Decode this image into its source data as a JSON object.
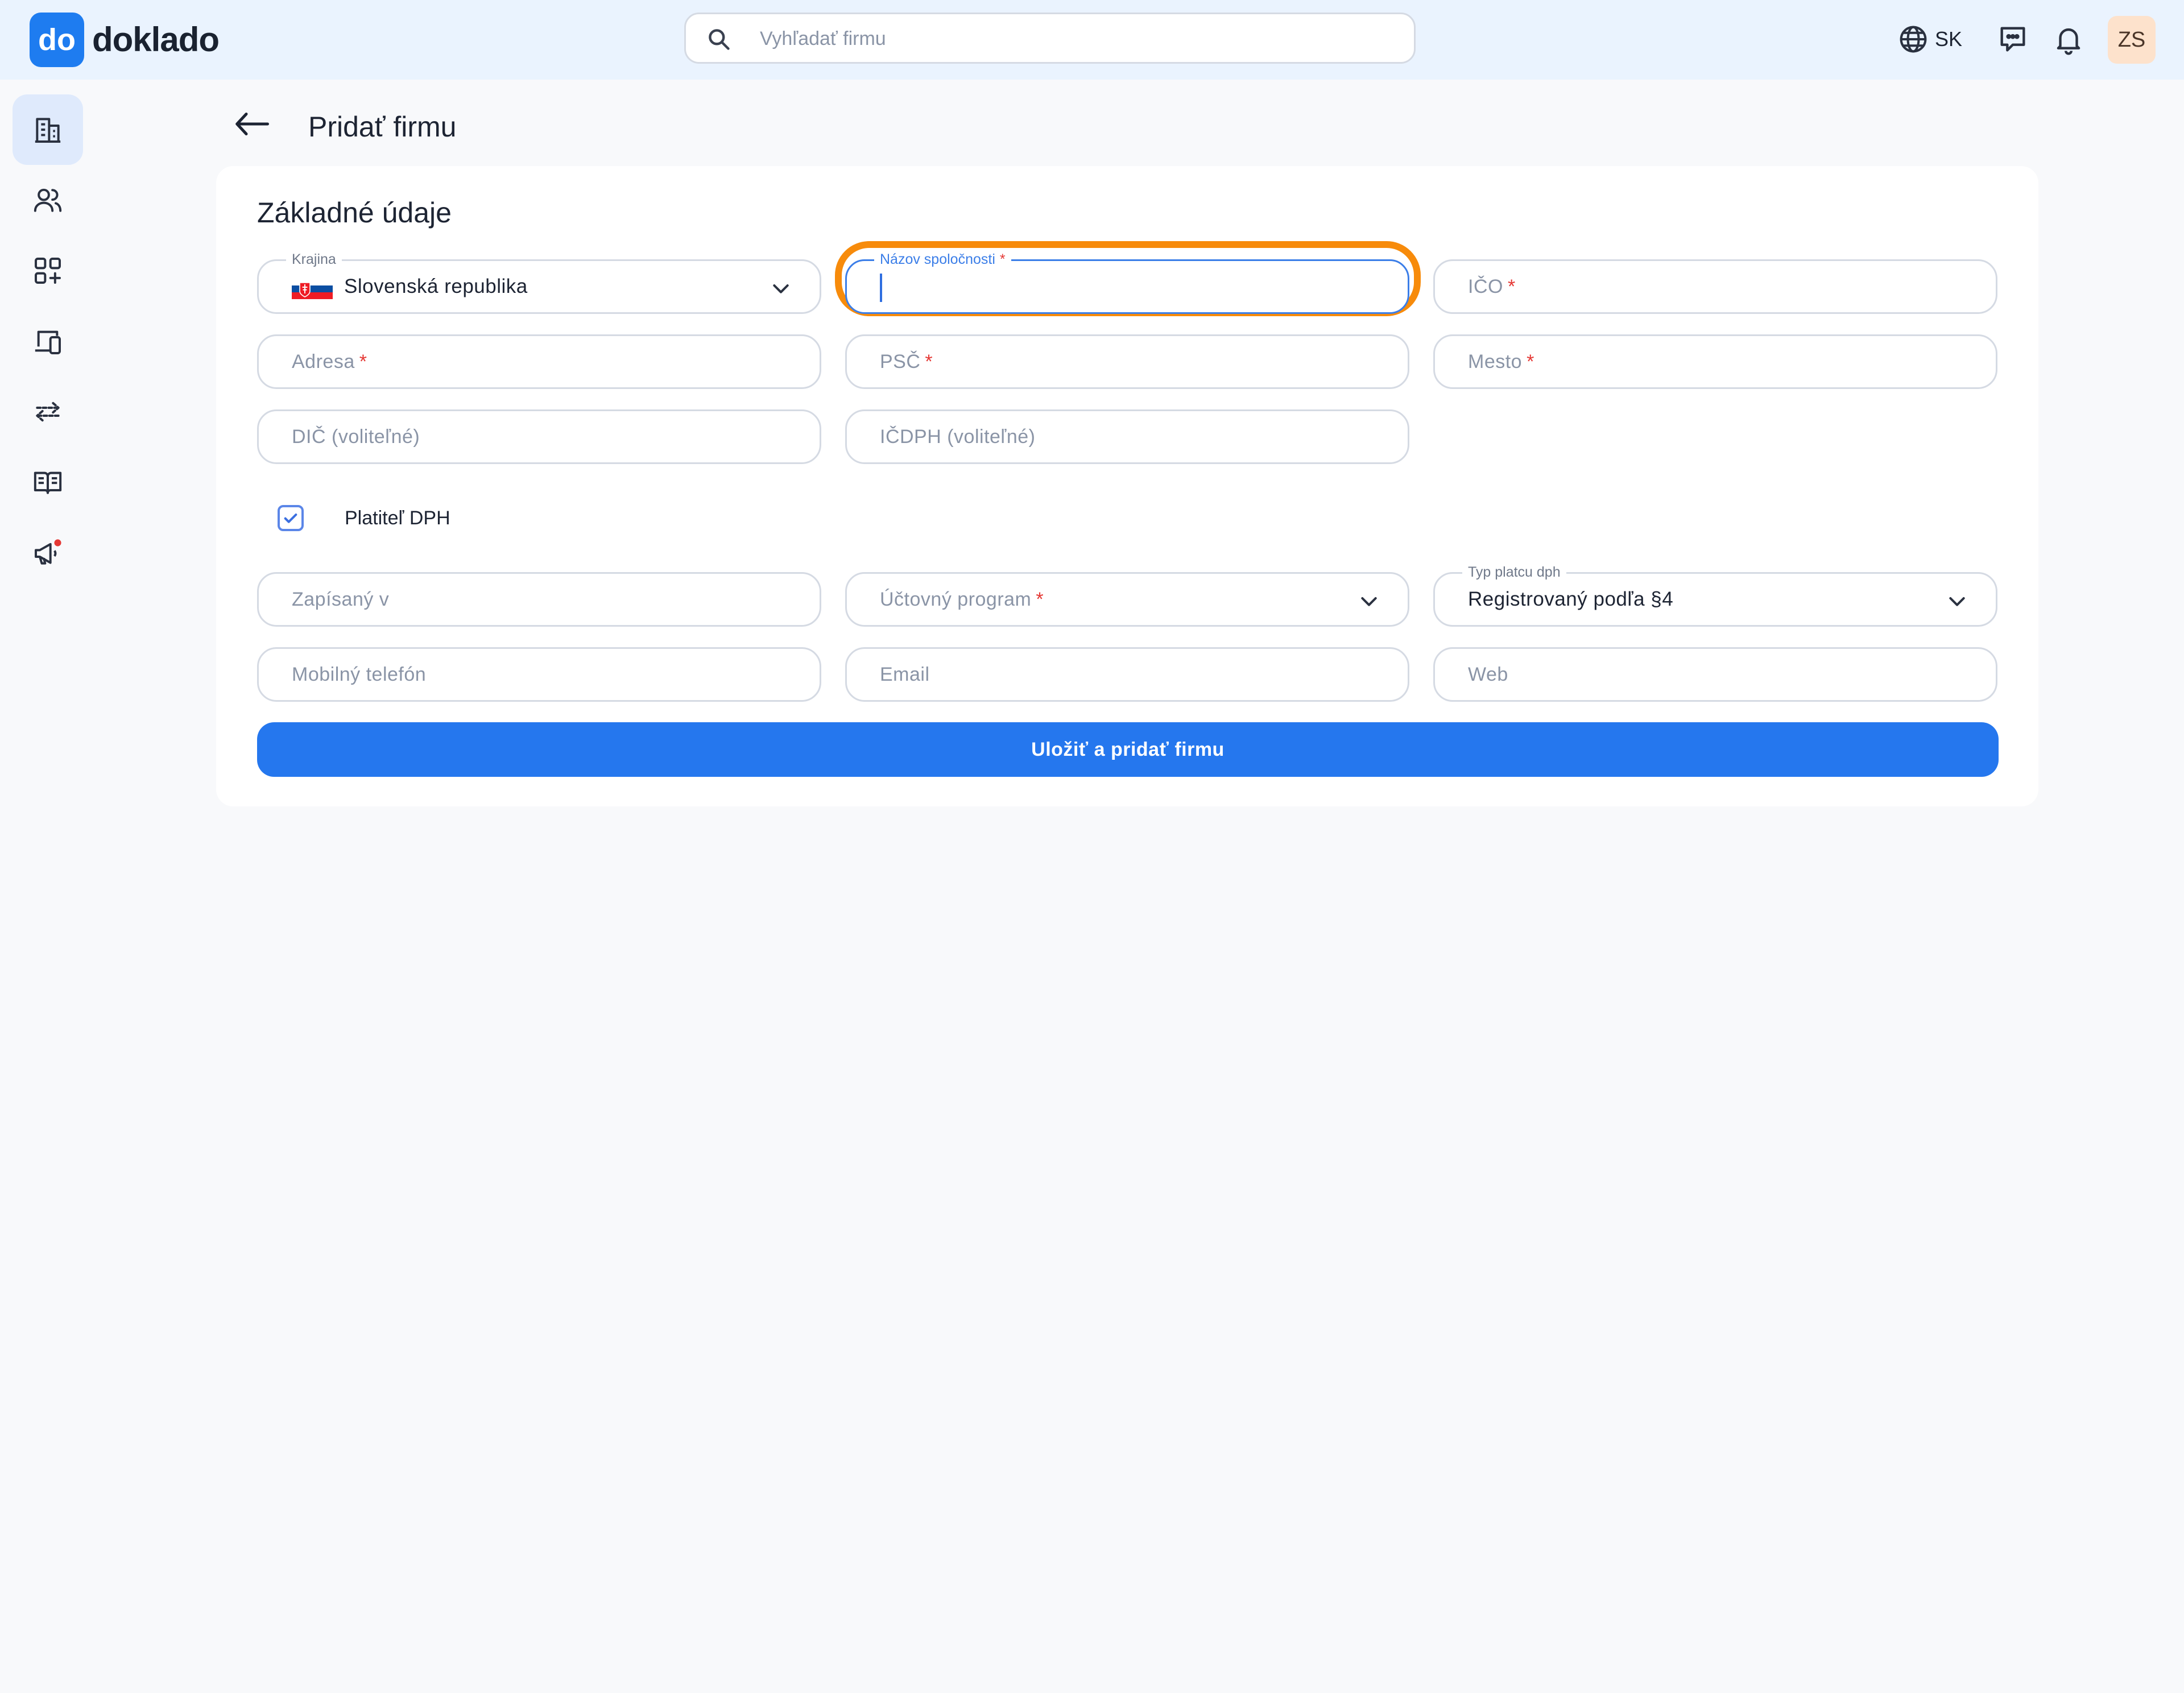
{
  "app": {
    "logo_badge": "do",
    "logo_name": "doklado"
  },
  "search": {
    "placeholder": "Vyhľadať firmu"
  },
  "header": {
    "language": "SK",
    "avatar_initials": "ZS"
  },
  "sidebar": {
    "items": [
      {
        "icon": "buildings-icon",
        "active": true
      },
      {
        "icon": "users-icon",
        "active": false
      },
      {
        "icon": "apps-add-icon",
        "active": false
      },
      {
        "icon": "devices-icon",
        "active": false
      },
      {
        "icon": "transfer-arrows-icon",
        "active": false
      },
      {
        "icon": "book-icon",
        "active": false
      },
      {
        "icon": "megaphone-icon",
        "active": false,
        "badge_color": "#e53935"
      }
    ]
  },
  "page": {
    "title": "Pridať firmu"
  },
  "form": {
    "section_title": "Základné údaje",
    "required_mark": "*",
    "country": {
      "label": "Krajina",
      "value": "Slovenská republika"
    },
    "company_name": {
      "label": "Názov spoločnosti",
      "value": ""
    },
    "ico": {
      "placeholder": "IČO"
    },
    "address": {
      "placeholder": "Adresa"
    },
    "psc": {
      "placeholder": "PSČ"
    },
    "city": {
      "placeholder": "Mesto"
    },
    "dic": {
      "placeholder": "DIČ (voliteľné)"
    },
    "icdph": {
      "placeholder": "IČDPH (voliteľné)"
    },
    "vat_payer": {
      "label": "Platiteľ DPH",
      "checked": true
    },
    "registered_in": {
      "placeholder": "Zapísaný v"
    },
    "accounting_program": {
      "placeholder": "Účtovný program"
    },
    "vat_payer_type": {
      "label": "Typ platcu dph",
      "value": "Registrovaný podľa §4"
    },
    "mobile": {
      "placeholder": "Mobilný telefón"
    },
    "email": {
      "placeholder": "Email"
    },
    "web": {
      "placeholder": "Web"
    },
    "save_button": "Uložiť a pridať firmu"
  },
  "colors": {
    "accent": "#2577ee",
    "focus_highlight": "#f78b0b",
    "topbar_bg": "#eaf3fe",
    "required": "#e53935"
  }
}
